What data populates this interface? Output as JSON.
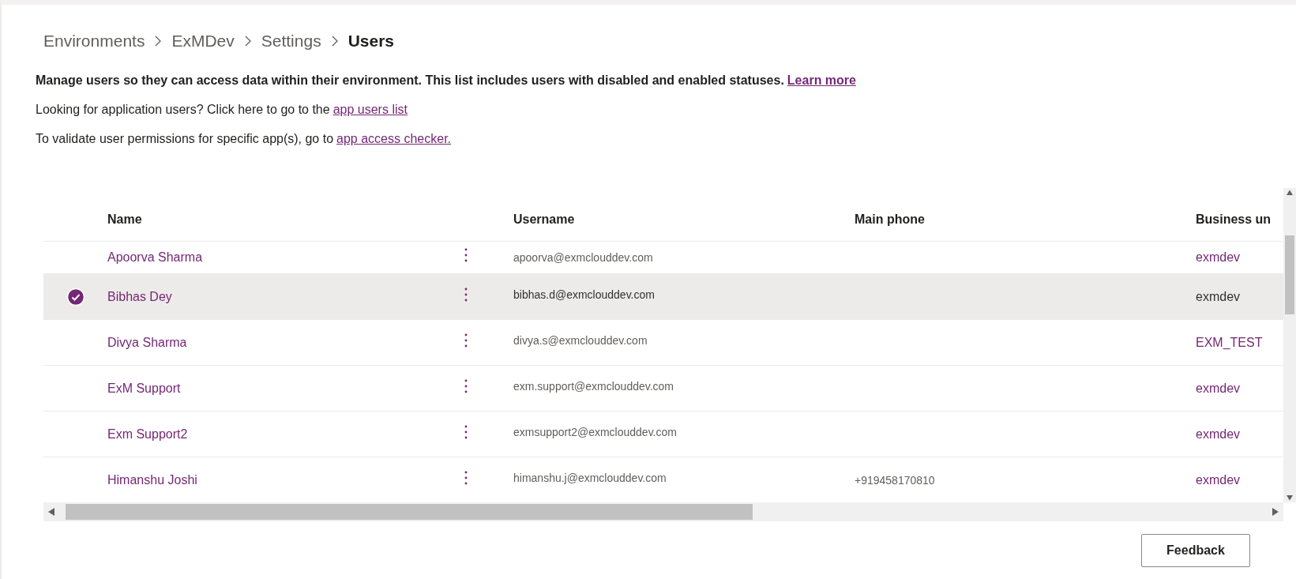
{
  "breadcrumb": [
    {
      "label": "Environments",
      "current": false
    },
    {
      "label": "ExMDev",
      "current": false
    },
    {
      "label": "Settings",
      "current": false
    },
    {
      "label": "Users",
      "current": true
    }
  ],
  "intro": {
    "text": "Manage users so they can access data within their environment. This list includes users with disabled and enabled statuses.",
    "link": "Learn more"
  },
  "notes": [
    {
      "text": "Looking for application users? Click here to go to the",
      "link": "app users list"
    },
    {
      "text": "To validate user permissions for specific app(s), go to",
      "link": "app access checker."
    }
  ],
  "table": {
    "columns": [
      "Name",
      "Username",
      "Main phone",
      "Business un"
    ],
    "rows": [
      {
        "name": "Apoorva Sharma",
        "username": "apoorva@exmclouddev.com",
        "business_unit": "exmdev",
        "selected": false
      },
      {
        "name": "Bibhas Dey",
        "username": "bibhas.d@exmclouddev.com",
        "business_unit": "exmdev",
        "selected": true
      },
      {
        "name": "Divya Sharma",
        "username": "divya.s@exmclouddev.com",
        "business_unit": "EXM_TEST",
        "selected": false
      },
      {
        "name": "ExM Support",
        "username": "exm.support@exmclouddev.com",
        "business_unit": "exmdev",
        "selected": false
      },
      {
        "name": "Exm Support2",
        "username": "exmsupport2@exmclouddev.com",
        "business_unit": "exmdev",
        "selected": false
      },
      {
        "name": "Himanshu Joshi",
        "username": "himanshu.j@exmclouddev.com",
        "main_phone": "+919458170810",
        "business_unit": "exmdev",
        "selected": false
      }
    ]
  },
  "feedback_button": "Feedback"
}
